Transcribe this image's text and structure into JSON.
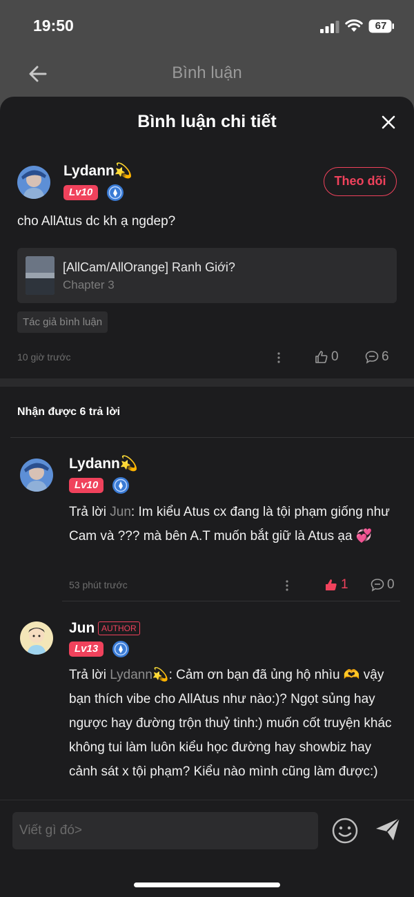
{
  "status_bar": {
    "time": "19:50",
    "battery": "67"
  },
  "background_header": {
    "title": "Bình luận"
  },
  "sheet": {
    "title": "Bình luận chi tiết"
  },
  "comment": {
    "username": "Lydann💫",
    "level": "Lv10",
    "follow_label": "Theo dõi",
    "text": "cho AllAtus dc kh ạ ngdep?",
    "story": {
      "title": "[AllCam/AllOrange] Ranh Giới?",
      "chapter": "Chapter 3"
    },
    "author_tag": "Tác giả bình luận",
    "time": "10 giờ trước",
    "likes": "0",
    "replies": "6"
  },
  "replies_header": "Nhận được 6 trả lời",
  "replies": [
    {
      "username": "Lydann💫",
      "level": "Lv10",
      "reply_prefix": "Trả lời ",
      "reply_to": "Jun",
      "text": ": Im kiểu Atus cx đang là tội phạm giống như Cam và ??? mà bên A.T muốn bắt giữ là Atus ạa 💞",
      "time": "53 phút trước",
      "likes": "1",
      "replies": "0"
    },
    {
      "username": "Jun",
      "author_badge": "AUTHOR",
      "level": "Lv13",
      "reply_prefix": "Trả lời ",
      "reply_to": "Lydann💫",
      "text": ": Cảm ơn bạn đã ủng hộ nhìu 🫶 vậy bạn thích vibe cho AllAtus như nào:)? Ngọt sủng hay ngược hay đường trộn thuỷ tinh:) muốn cốt truyện khác không tui làm luôn kiểu học đường hay showbiz hay cảnh sát x tội phạm? Kiểu nào mình cũng làm được:)"
    }
  ],
  "input": {
    "placeholder": "Viết gì đó>"
  },
  "colors": {
    "accent": "#f0425c",
    "background": "#1c1c1e",
    "card": "#2c2c2e"
  }
}
